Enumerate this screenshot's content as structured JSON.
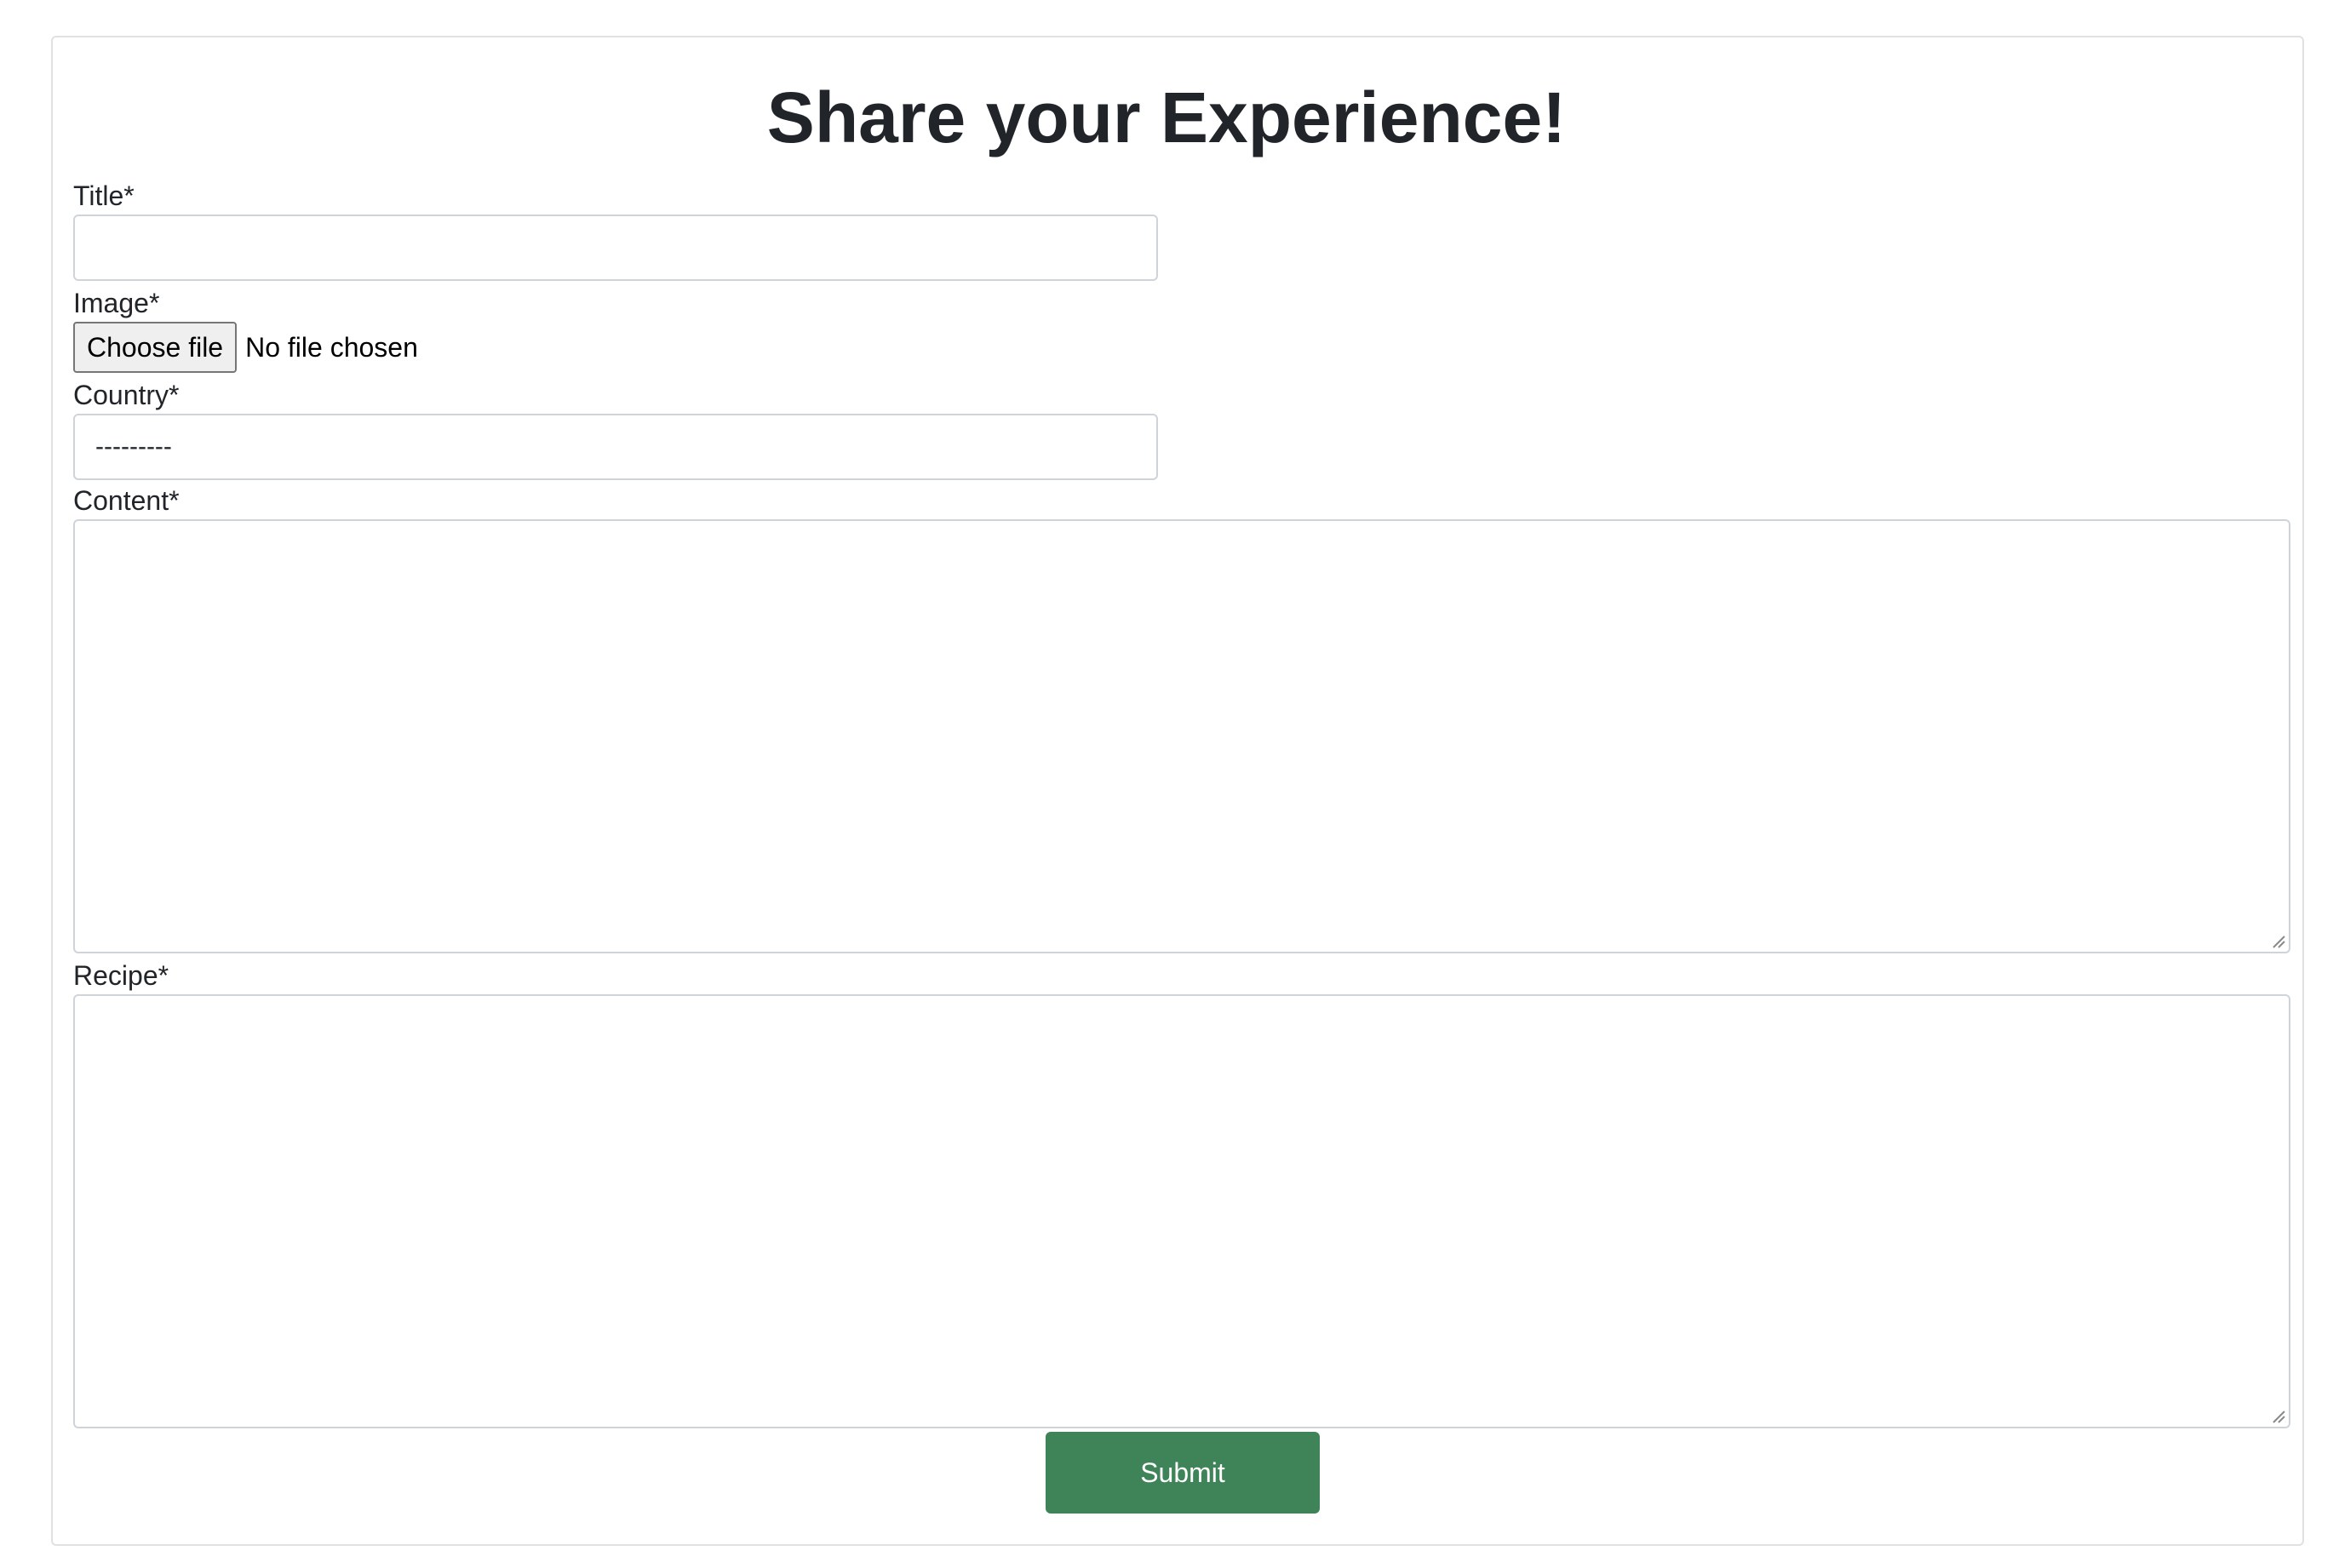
{
  "form": {
    "heading": "Share your Experience!",
    "fields": {
      "title": {
        "label": "Title*",
        "value": "",
        "placeholder": ""
      },
      "image": {
        "label": "Image*",
        "button_label": "Choose file",
        "status": "No file chosen"
      },
      "country": {
        "label": "Country*",
        "selected": "---------"
      },
      "content": {
        "label": "Content*",
        "value": ""
      },
      "recipe": {
        "label": "Recipe*",
        "value": ""
      }
    },
    "submit_label": "Submit"
  },
  "colors": {
    "submit_bg": "#3f8458",
    "text": "#212529",
    "border": "#ced4da",
    "card_border": "#e1e1e1"
  },
  "icons": {
    "textarea_resize": "resize-grip-icon"
  }
}
